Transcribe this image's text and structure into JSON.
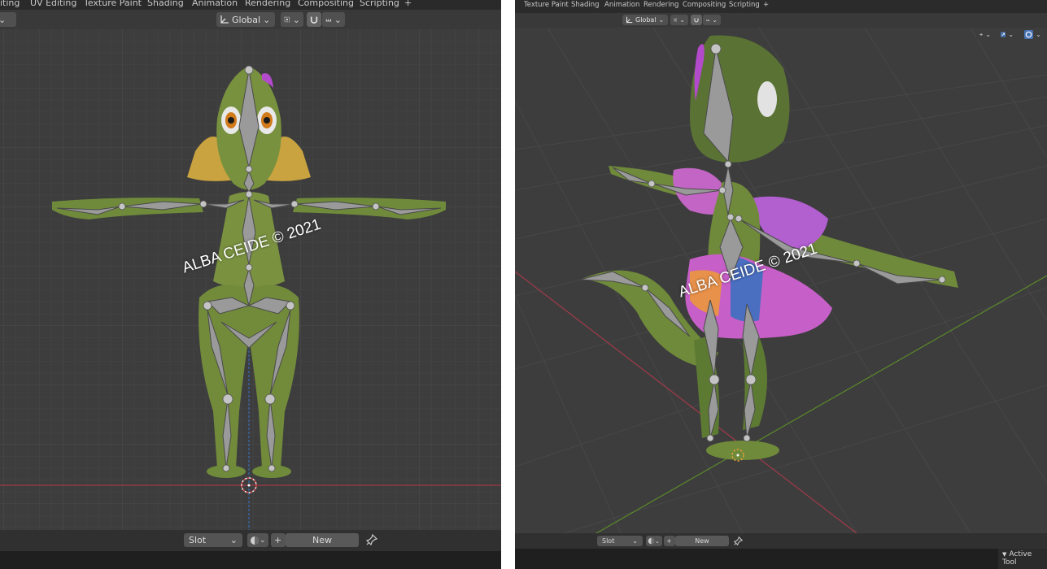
{
  "left": {
    "tabs": [
      "iting",
      "UV Editing",
      "Texture Paint",
      "Shading",
      "Animation",
      "Rendering",
      "Compositing",
      "Scripting",
      "+"
    ],
    "transform_orientation": "Global",
    "slot_label": "Slot",
    "new_label": "New",
    "watermark": "ALBA CEIDE © 2021"
  },
  "right": {
    "tabs": [
      "Texture Paint",
      "Shading",
      "Animation",
      "Rendering",
      "Compositing",
      "Scripting",
      "+"
    ],
    "transform_orientation": "Global",
    "slot_label": "Slot",
    "new_label": "New",
    "watermark": "ALBA CEIDE © 2021",
    "active_tool_label": "Active Tool"
  },
  "icons": {
    "orientation": "axis-orientation-icon",
    "pivot": "pivot-point-icon",
    "snap": "snap-magnet-icon",
    "snap_increment": "snap-increment-icon",
    "material_sphere": "material-sphere-icon",
    "pin": "pin-icon",
    "plus": "plus-icon",
    "visibility": "visibility-eye-icon",
    "gizmo": "gizmo-icon",
    "overlay": "overlay-icon"
  },
  "colors": {
    "viewport_bg": "#3d3d3d",
    "grid": "#474747",
    "x_axis": "#a23a4a",
    "y_axis": "#5b8a2a",
    "z_axis": "#3a6fb2",
    "bone": "#9a9a9a",
    "skin": "#6f8a3a"
  }
}
